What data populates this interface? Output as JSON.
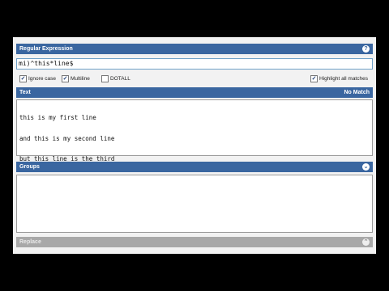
{
  "regex_panel": {
    "title": "Regular Expression",
    "help_icon": "question-icon",
    "help_label": "?",
    "pattern": "mi)^this*line$"
  },
  "options": {
    "ignore_case": {
      "label": "Ignore case",
      "checked": true
    },
    "multiline": {
      "label": "Multiline",
      "checked": true
    },
    "dotall": {
      "label": "DOTALL",
      "checked": false
    },
    "highlight_all": {
      "label": "Highlight all matches",
      "checked": true
    },
    "check_mark": "✓"
  },
  "text_panel": {
    "title": "Text",
    "status": "No Match",
    "lines": [
      "this is my first line",
      "and this is my second line",
      "but this line is the third"
    ]
  },
  "groups_panel": {
    "title": "Groups",
    "toggle_icon": "chevron-down-icon",
    "toggle_label": "⌄"
  },
  "replace_panel": {
    "title": "Replace",
    "toggle_icon": "chevron-up-icon",
    "toggle_label": "⌃"
  },
  "colors": {
    "header_blue": "#3a66a0",
    "disabled_gray": "#a8a8a8",
    "input_border": "#6fa0c8"
  }
}
